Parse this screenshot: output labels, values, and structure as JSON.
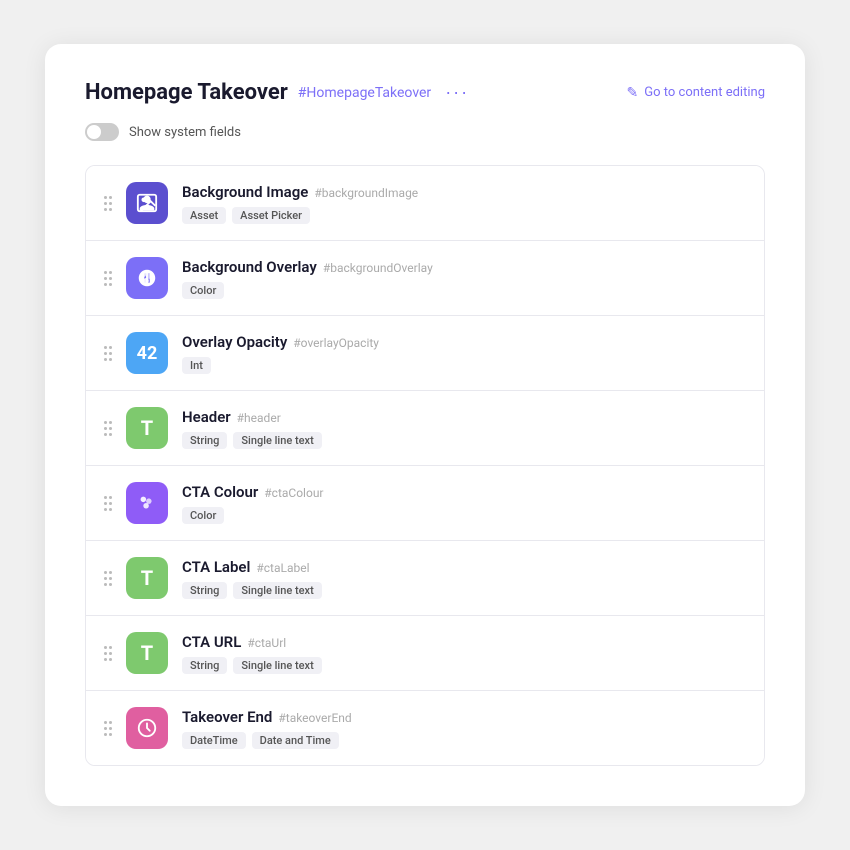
{
  "header": {
    "title": "Homepage Takeover",
    "hash_label": "#HomepageTakeover",
    "more_label": "···",
    "go_to_editing_label": "Go to content editing"
  },
  "system_fields": {
    "toggle_label": "Show system fields"
  },
  "fields": [
    {
      "id": "background-image",
      "name": "Background Image",
      "hash": "#backgroundImage",
      "icon_type": "camera",
      "icon_color": "purple-dark",
      "tags": [
        "Asset",
        "Asset Picker"
      ]
    },
    {
      "id": "background-overlay",
      "name": "Background Overlay",
      "hash": "#backgroundOverlay",
      "icon_type": "palette",
      "icon_color": "purple-light",
      "tags": [
        "Color"
      ]
    },
    {
      "id": "overlay-opacity",
      "name": "Overlay Opacity",
      "hash": "#overlayOpacity",
      "icon_type": "number",
      "icon_value": "42",
      "icon_color": "blue",
      "tags": [
        "Int"
      ]
    },
    {
      "id": "header",
      "name": "Header",
      "hash": "#header",
      "icon_type": "text",
      "icon_color": "green",
      "tags": [
        "String",
        "Single line text"
      ]
    },
    {
      "id": "cta-colour",
      "name": "CTA Colour",
      "hash": "#ctaColour",
      "icon_type": "palette",
      "icon_color": "purple-medium",
      "tags": [
        "Color"
      ]
    },
    {
      "id": "cta-label",
      "name": "CTA Label",
      "hash": "#ctaLabel",
      "icon_type": "text",
      "icon_color": "green2",
      "tags": [
        "String",
        "Single line text"
      ]
    },
    {
      "id": "cta-url",
      "name": "CTA URL",
      "hash": "#ctaUrl",
      "icon_type": "text",
      "icon_color": "green3",
      "tags": [
        "String",
        "Single line text"
      ]
    },
    {
      "id": "takeover-end",
      "name": "Takeover End",
      "hash": "#takeoverEnd",
      "icon_type": "clock",
      "icon_color": "pink",
      "tags": [
        "DateTime",
        "Date and Time"
      ]
    }
  ]
}
